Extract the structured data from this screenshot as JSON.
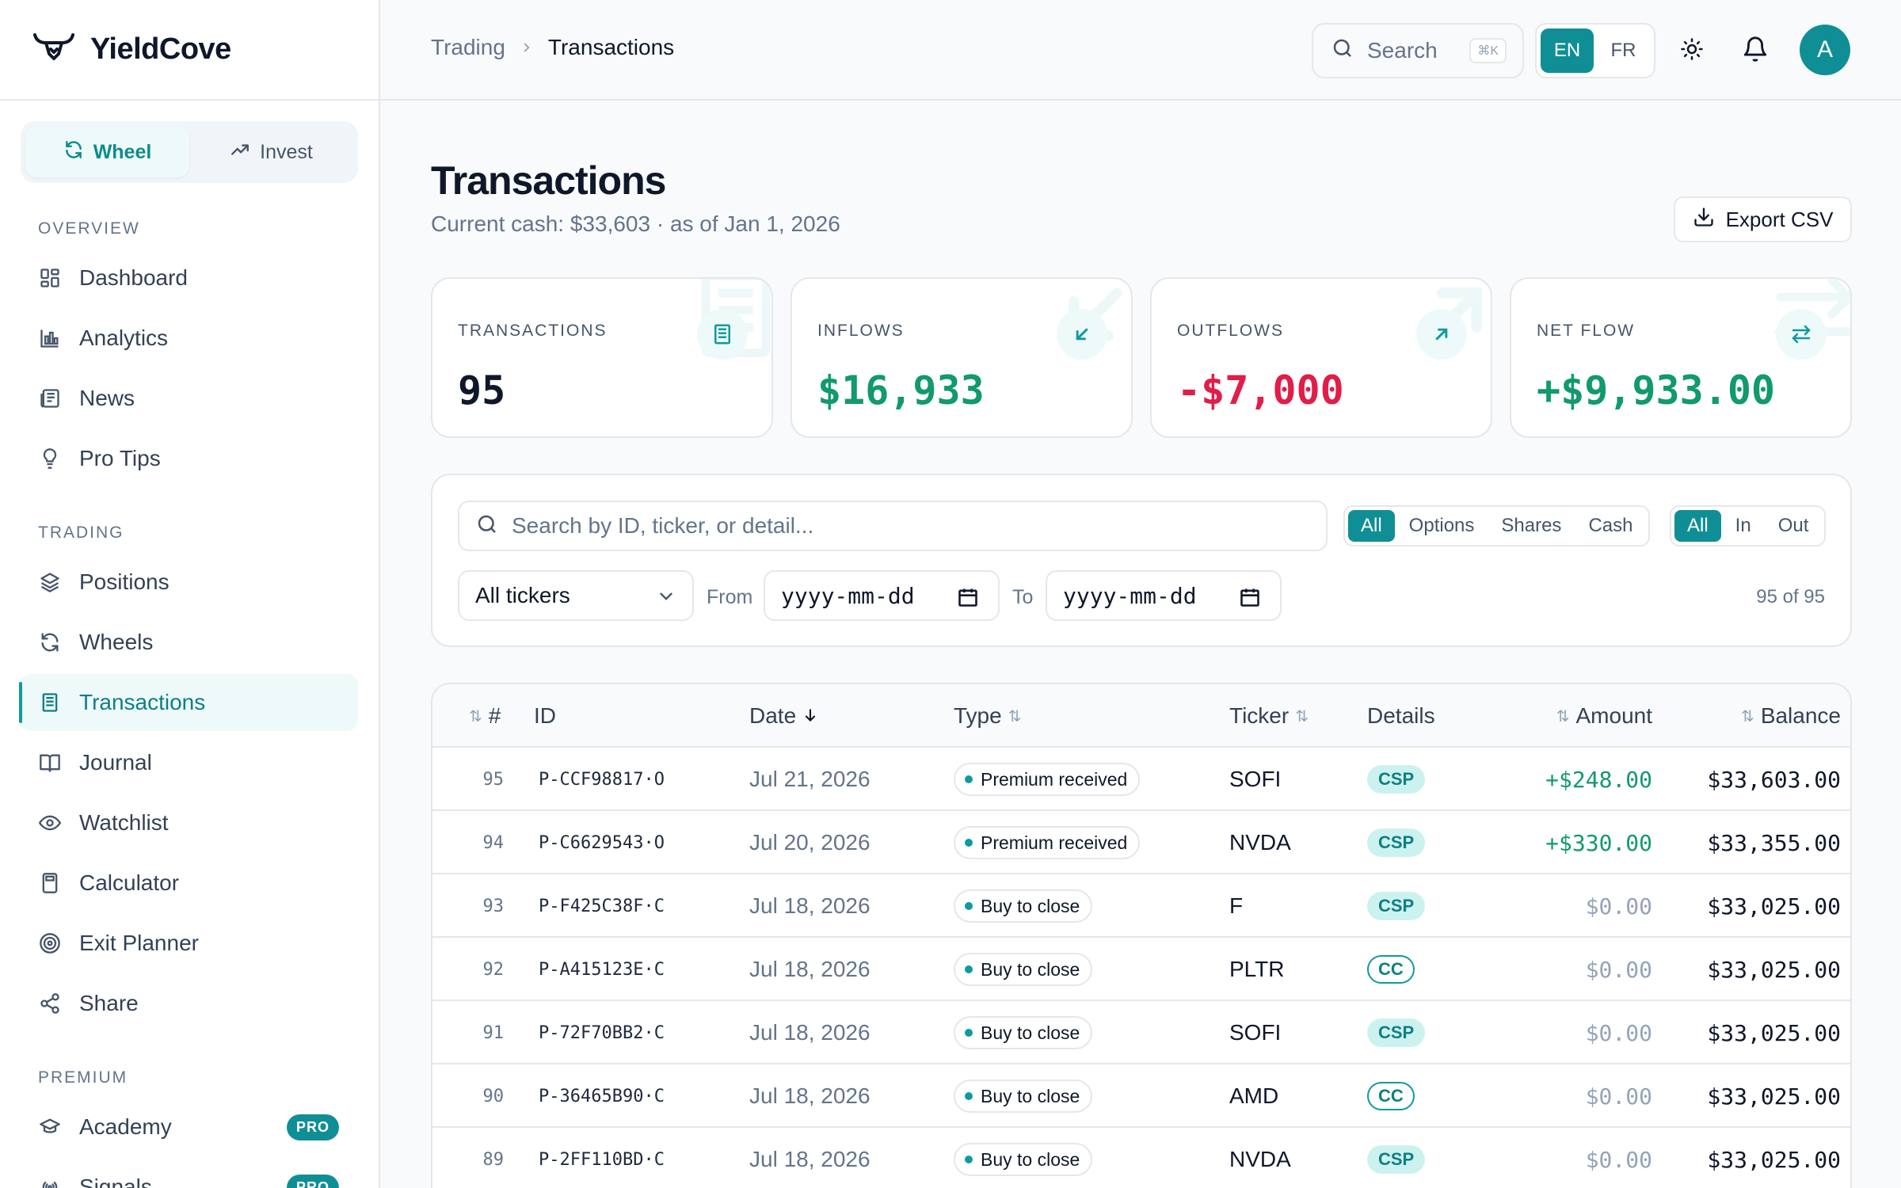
{
  "app": {
    "name": "YieldCove"
  },
  "sidebar": {
    "modes": [
      {
        "label": "Wheel",
        "icon": "refresh-icon",
        "active": true
      },
      {
        "label": "Invest",
        "icon": "trending-up-icon",
        "active": false
      }
    ],
    "sections": [
      {
        "label": "OVERVIEW",
        "items": [
          {
            "label": "Dashboard",
            "icon": "dashboard-icon"
          },
          {
            "label": "Analytics",
            "icon": "bar-chart-icon"
          },
          {
            "label": "News",
            "icon": "newspaper-icon"
          },
          {
            "label": "Pro Tips",
            "icon": "lightbulb-icon"
          }
        ]
      },
      {
        "label": "TRADING",
        "items": [
          {
            "label": "Positions",
            "icon": "layers-icon"
          },
          {
            "label": "Wheels",
            "icon": "refresh-icon"
          },
          {
            "label": "Transactions",
            "icon": "receipt-icon",
            "active": true
          },
          {
            "label": "Journal",
            "icon": "book-icon"
          },
          {
            "label": "Watchlist",
            "icon": "eye-icon"
          },
          {
            "label": "Calculator",
            "icon": "calculator-icon"
          },
          {
            "label": "Exit Planner",
            "icon": "target-icon"
          },
          {
            "label": "Share",
            "icon": "share-icon"
          }
        ]
      },
      {
        "label": "PREMIUM",
        "items": [
          {
            "label": "Academy",
            "icon": "graduation-cap-icon",
            "badge": "PRO"
          },
          {
            "label": "Signals",
            "icon": "signal-icon",
            "badge": "PRO"
          }
        ]
      }
    ]
  },
  "topbar": {
    "breadcrumb": {
      "parent": "Trading",
      "current": "Transactions"
    },
    "search": {
      "placeholder": "Search",
      "shortcut": "⌘K"
    },
    "languages": [
      {
        "label": "EN",
        "active": true
      },
      {
        "label": "FR",
        "active": false
      }
    ],
    "avatar_initial": "A"
  },
  "page": {
    "title": "Transactions",
    "subtitle": "Current cash: $33,603 · as of Jan 1, 2026",
    "export_label": "Export CSV"
  },
  "stats": [
    {
      "label": "TRANSACTIONS",
      "value": "95",
      "color": "#0f172a",
      "icon": "receipt-icon"
    },
    {
      "label": "INFLOWS",
      "value": "$16,933",
      "color": "#119a6b",
      "icon": "arrow-down-left-icon"
    },
    {
      "label": "OUTFLOWS",
      "value": "-$7,000",
      "color": "#e11d48",
      "icon": "arrow-up-right-icon"
    },
    {
      "label": "NET FLOW",
      "value": "+$9,933.00",
      "color": "#119a6b",
      "icon": "arrows-left-right-icon"
    }
  ],
  "filters": {
    "search_placeholder": "Search by ID, ticker, or detail...",
    "type_options": [
      {
        "label": "All",
        "active": true
      },
      {
        "label": "Options"
      },
      {
        "label": "Shares"
      },
      {
        "label": "Cash"
      }
    ],
    "direction_options": [
      {
        "label": "All",
        "active": true
      },
      {
        "label": "In"
      },
      {
        "label": "Out"
      }
    ],
    "ticker_select": "All tickers",
    "from_label": "From",
    "to_label": "To",
    "date_placeholder": "yyyy-mm-dd",
    "count": "95 of 95"
  },
  "table": {
    "headers": {
      "num": "#",
      "id": "ID",
      "date": "Date",
      "type": "Type",
      "ticker": "Ticker",
      "details": "Details",
      "amount": "Amount",
      "balance": "Balance"
    },
    "rows": [
      {
        "num": "95",
        "id": "P-CCF98817·O",
        "date": "Jul 21, 2026",
        "type": "Premium received",
        "ticker": "SOFI",
        "details": "CSP",
        "amount": "+$248.00",
        "positive": true,
        "balance": "$33,603.00"
      },
      {
        "num": "94",
        "id": "P-C6629543·O",
        "date": "Jul 20, 2026",
        "type": "Premium received",
        "ticker": "NVDA",
        "details": "CSP",
        "amount": "+$330.00",
        "positive": true,
        "balance": "$33,355.00"
      },
      {
        "num": "93",
        "id": "P-F425C38F·C",
        "date": "Jul 18, 2026",
        "type": "Buy to close",
        "ticker": "F",
        "details": "CSP",
        "amount": "$0.00",
        "positive": false,
        "balance": "$33,025.00"
      },
      {
        "num": "92",
        "id": "P-A415123E·C",
        "date": "Jul 18, 2026",
        "type": "Buy to close",
        "ticker": "PLTR",
        "details": "CC",
        "amount": "$0.00",
        "positive": false,
        "balance": "$33,025.00"
      },
      {
        "num": "91",
        "id": "P-72F70BB2·C",
        "date": "Jul 18, 2026",
        "type": "Buy to close",
        "ticker": "SOFI",
        "details": "CSP",
        "amount": "$0.00",
        "positive": false,
        "balance": "$33,025.00"
      },
      {
        "num": "90",
        "id": "P-36465B90·C",
        "date": "Jul 18, 2026",
        "type": "Buy to close",
        "ticker": "AMD",
        "details": "CC",
        "amount": "$0.00",
        "positive": false,
        "balance": "$33,025.00"
      },
      {
        "num": "89",
        "id": "P-2FF110BD·C",
        "date": "Jul 18, 2026",
        "type": "Buy to close",
        "ticker": "NVDA",
        "details": "CSP",
        "amount": "$0.00",
        "positive": false,
        "balance": "$33,025.00"
      }
    ]
  }
}
